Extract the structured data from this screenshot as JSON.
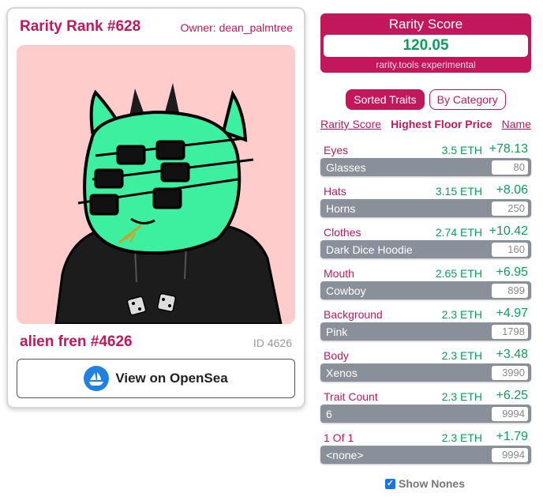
{
  "card": {
    "rank_title": "Rarity Rank #628",
    "owner_label": "Owner:",
    "owner_name": "dean_palmtree",
    "nft_name": "alien fren #4626",
    "id_label": "ID",
    "id_value": "4626",
    "opensea_button": "View on OpenSea"
  },
  "score": {
    "title": "Rarity Score",
    "value": "120.05",
    "subtitle": "rarity.tools experimental"
  },
  "tabs": [
    {
      "label": "Sorted Traits",
      "active": true
    },
    {
      "label": "By Category",
      "active": false
    }
  ],
  "sort": {
    "rarity_score": "Rarity Score",
    "highest_floor": "Highest Floor Price",
    "name": "Name"
  },
  "traits": [
    {
      "name": "Eyes",
      "floor": "3.5 ETH",
      "score": "+78.13",
      "value": "Glasses",
      "count": "80"
    },
    {
      "name": "Hats",
      "floor": "3.15 ETH",
      "score": "+8.06",
      "value": "Horns",
      "count": "250"
    },
    {
      "name": "Clothes",
      "floor": "2.74 ETH",
      "score": "+10.42",
      "value": "Dark Dice Hoodie",
      "count": "160"
    },
    {
      "name": "Mouth",
      "floor": "2.65 ETH",
      "score": "+6.95",
      "value": "Cowboy",
      "count": "899"
    },
    {
      "name": "Background",
      "floor": "2.3 ETH",
      "score": "+4.97",
      "value": "Pink",
      "count": "1798"
    },
    {
      "name": "Body",
      "floor": "2.3 ETH",
      "score": "+3.48",
      "value": "Xenos",
      "count": "3990"
    },
    {
      "name": "Trait Count",
      "floor": "2.3 ETH",
      "score": "+6.25",
      "value": "6",
      "count": "9994"
    },
    {
      "name": "1 Of 1",
      "floor": "2.3 ETH",
      "score": "+1.79",
      "value": "<none>",
      "count": "9994"
    }
  ],
  "show_nones": {
    "label": "Show Nones",
    "checked": true
  },
  "colors": {
    "accent": "#c2185b",
    "positive": "#0b9e5b",
    "bar": "#8a909a",
    "image_background": "#ffcccc",
    "alien_skin": "#3cf0a0",
    "hoodie": "#1c1c1c",
    "opensea_blue": "#2081e2"
  },
  "icons": {
    "opensea": "opensea-logo-icon",
    "checkbox": "checkmark-icon"
  }
}
